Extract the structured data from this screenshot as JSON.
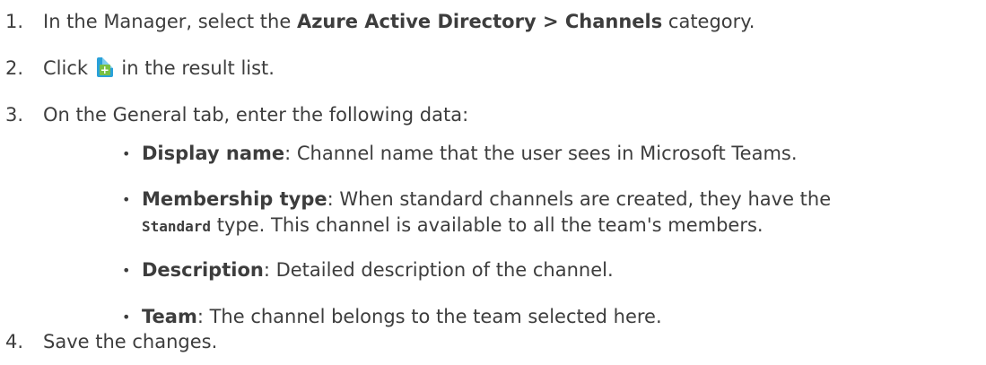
{
  "steps": [
    {
      "number": "1.",
      "before": "In the Manager, select the ",
      "bold": "Azure Active Directory > Channels",
      "after": " category."
    },
    {
      "number": "2.",
      "before": "Click ",
      "icon": "new-object-icon",
      "after": " in the result list."
    },
    {
      "number": "3.",
      "text": "On the General tab, enter the following data:"
    },
    {
      "number": "4.",
      "text": "Save the changes."
    }
  ],
  "bullets": [
    {
      "label": "Display name",
      "text": ": Channel name that the user sees in Microsoft Teams."
    },
    {
      "label": "Membership type",
      "text": ": When standard channels are created, they have the",
      "code": "Standard",
      "text2": " type. This channel is available to all the team's members."
    },
    {
      "label": "Description",
      "text": ": Detailed description of the channel."
    },
    {
      "label": "Team",
      "text": ": The channel belongs to the team selected here."
    }
  ],
  "bullet_glyph": "•",
  "colors": {
    "text": "#3d3d3d",
    "icon_page": "#2aa1d9",
    "icon_plus": "#79c143"
  }
}
